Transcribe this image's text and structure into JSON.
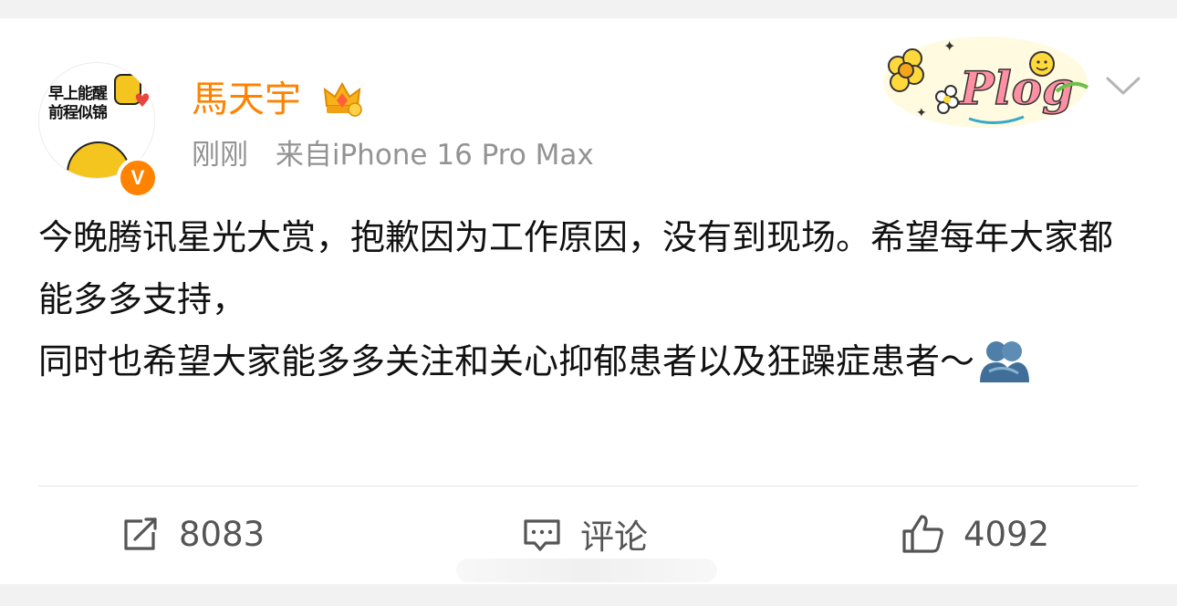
{
  "post": {
    "author": {
      "name": "馬天宇",
      "avatar_text": [
        "早上能醒",
        "前程似锦"
      ],
      "verified_badge": "V",
      "crown_icon": "crown-badge-icon"
    },
    "meta": {
      "time": "刚刚",
      "source": "来自iPhone 16 Pro Max"
    },
    "decoration": {
      "label": "Plog"
    },
    "content": {
      "paragraphs": [
        "今晚腾讯星光大赏，抱歉因为工作原因，没有到现场。希望每年大家都能多多支持，",
        "同时也希望大家能多多关注和关心抑郁患者以及狂躁症患者～"
      ],
      "trailing_emoji": "hug-emoji"
    },
    "actions": {
      "repost": {
        "icon": "repost-icon",
        "label": "8083"
      },
      "comment": {
        "icon": "comment-icon",
        "label": "评论"
      },
      "like": {
        "icon": "thumbs-up-icon",
        "label": "4092"
      }
    },
    "colors": {
      "username": "#ff8200",
      "meta": "#939393",
      "text": "#111111",
      "actions": "#555555",
      "badge": "#ff8200"
    }
  }
}
